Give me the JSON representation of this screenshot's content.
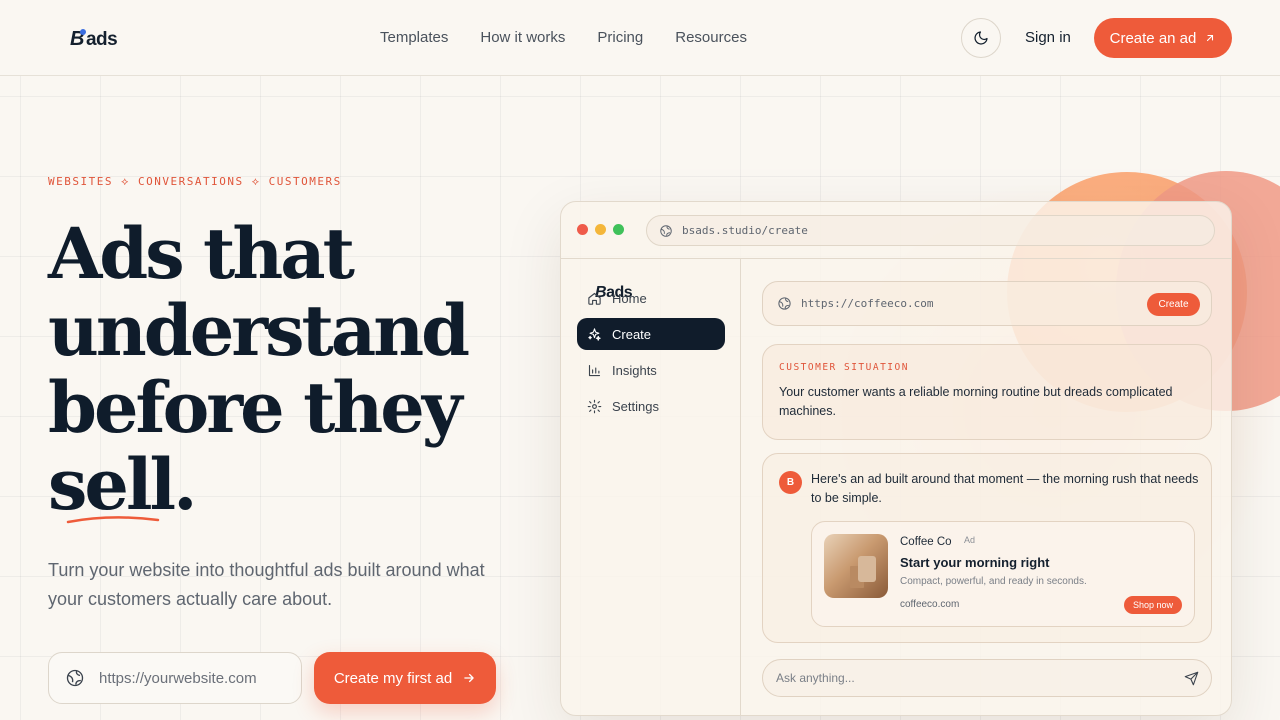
{
  "header": {
    "logo_text": "ads",
    "nav": [
      "Templates",
      "How it works",
      "Pricing",
      "Resources"
    ],
    "signin_label": "Sign in",
    "cta_label": "Create an ad"
  },
  "hero": {
    "eyebrow": "WEBSITES ⟡ CONVERSATIONS ⟡ CUSTOMERS",
    "headline_lines": [
      "Ads that",
      "understand",
      "before they",
      "sell."
    ],
    "subtitle": "Turn your website into thoughtful ads built around what your customers actually care about.",
    "url_placeholder": "https://yourwebsite.com",
    "cta_label": "Create my first ad"
  },
  "app": {
    "address": "bsads.studio/create",
    "sidebar": {
      "logo_text": "ads",
      "items": [
        {
          "label": "Home",
          "icon": "home-icon",
          "active": false
        },
        {
          "label": "Create",
          "icon": "sparkle-icon",
          "active": true
        },
        {
          "label": "Insights",
          "icon": "bar-chart-icon",
          "active": false
        },
        {
          "label": "Settings",
          "icon": "gear-icon",
          "active": false
        }
      ]
    },
    "url_value": "https://coffeeco.com",
    "create_label": "Create",
    "situation": {
      "label": "CUSTOMER SITUATION",
      "text": "Your customer wants a reliable morning routine but dreads complicated machines."
    },
    "response": {
      "avatar": "B",
      "text": "Here's an ad built around that moment — the morning rush that needs to be simple.",
      "ad": {
        "brand": "Coffee Co",
        "tag": "Ad",
        "title": "Start your morning right",
        "description": "Compact, powerful, and ready in seconds.",
        "domain": "coffeeco.com",
        "button": "Shop now"
      }
    },
    "ask_placeholder": "Ask anything..."
  },
  "colors": {
    "accent": "#ee5b3a",
    "navy": "#101c2b",
    "background": "#faf7f2"
  }
}
